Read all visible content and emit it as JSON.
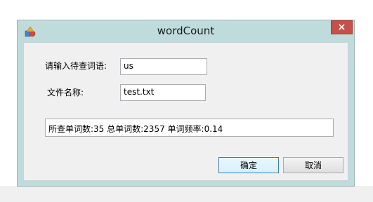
{
  "window": {
    "title": "wordCount",
    "close_label": "×"
  },
  "form": {
    "word_label": "请输入待查词语:",
    "word_value": "us",
    "file_label": "文件名称:",
    "file_value": "test.txt",
    "result_value": "所查单词数:35  总单词数:2357 单词频率:0.14"
  },
  "buttons": {
    "ok_label": "确定",
    "cancel_label": "取消"
  },
  "icons": {
    "app": "app-shapes-icon",
    "close": "close-icon"
  },
  "colors": {
    "frame": "#bfdbdc",
    "close_button": "#c7504a",
    "client": "#f0f0f0"
  }
}
